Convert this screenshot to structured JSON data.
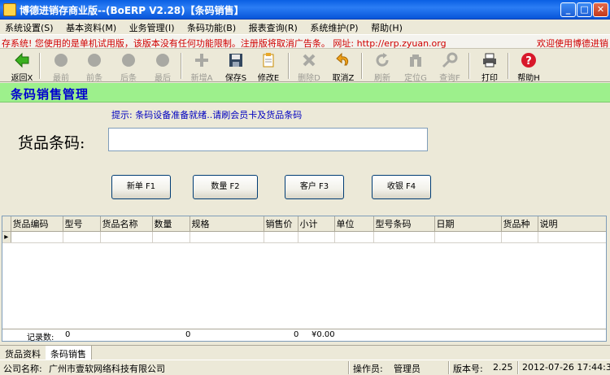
{
  "window": {
    "title": "博德进销存商业版--(BoERP V2.28)【条码销售】"
  },
  "menu": [
    "系统设置(S)",
    "基本资料(M)",
    "业务管理(I)",
    "条码功能(B)",
    "报表查询(R)",
    "系统维护(P)",
    "帮助(H)"
  ],
  "notice": {
    "message": "存系统! 您使用的是单机试用版，该版本没有任何功能限制。注册版将取消广告条。  网址: http://erp.zyuan.org",
    "welcome": "欢迎使用博德进销"
  },
  "toolbar": [
    {
      "label": "返回X",
      "icon": "back-arrow-icon",
      "enabled": true
    },
    {
      "label": "最前",
      "icon": "first-record-icon",
      "enabled": false
    },
    {
      "label": "前条",
      "icon": "prev-record-icon",
      "enabled": false
    },
    {
      "label": "后条",
      "icon": "next-record-icon",
      "enabled": false
    },
    {
      "label": "最后",
      "icon": "last-record-icon",
      "enabled": false
    },
    {
      "label": "新增A",
      "icon": "add-icon",
      "enabled": false
    },
    {
      "label": "保存S",
      "icon": "save-icon",
      "enabled": true
    },
    {
      "label": "修改E",
      "icon": "edit-icon",
      "enabled": true
    },
    {
      "label": "删除D",
      "icon": "delete-icon",
      "enabled": false
    },
    {
      "label": "取消Z",
      "icon": "undo-icon",
      "enabled": true
    },
    {
      "label": "刷新",
      "icon": "refresh-icon",
      "enabled": false
    },
    {
      "label": "定位G",
      "icon": "locate-icon",
      "enabled": false
    },
    {
      "label": "查询F",
      "icon": "search-icon",
      "enabled": false
    },
    {
      "label": "打印",
      "icon": "printer-icon",
      "enabled": true
    },
    {
      "label": "帮助H",
      "icon": "help-icon",
      "enabled": true
    }
  ],
  "module": {
    "title": "条码销售管理"
  },
  "form": {
    "hint": "提示: 条码设备准备就绪..请刷会员卡及货品条码",
    "barcode_label": "货品条码:",
    "barcode_value": ""
  },
  "actions": {
    "new_order": "新单 F1",
    "quantity": "数量 F2",
    "customer": "客户 F3",
    "checkout": "收银 F4"
  },
  "grid": {
    "columns": [
      "货品编码",
      "型号",
      "货品名称",
      "数量",
      "规格",
      "销售价",
      "小计",
      "单位",
      "型号条码",
      "日期",
      "货品种",
      "说明"
    ],
    "footer": {
      "label": "记录数:",
      "count": "0",
      "qty_total": "0",
      "price_total": "0",
      "subtotal": "¥0.00"
    }
  },
  "tabs": [
    "货品资料",
    "条码销售"
  ],
  "status": {
    "company_label": "公司名称:",
    "company": "广州市壹软网络科技有限公司",
    "operator_label": "操作员:",
    "operator": "管理员",
    "version_label": "版本号:",
    "version": "2.25",
    "datetime": "2012-07-26 17:44:35"
  }
}
